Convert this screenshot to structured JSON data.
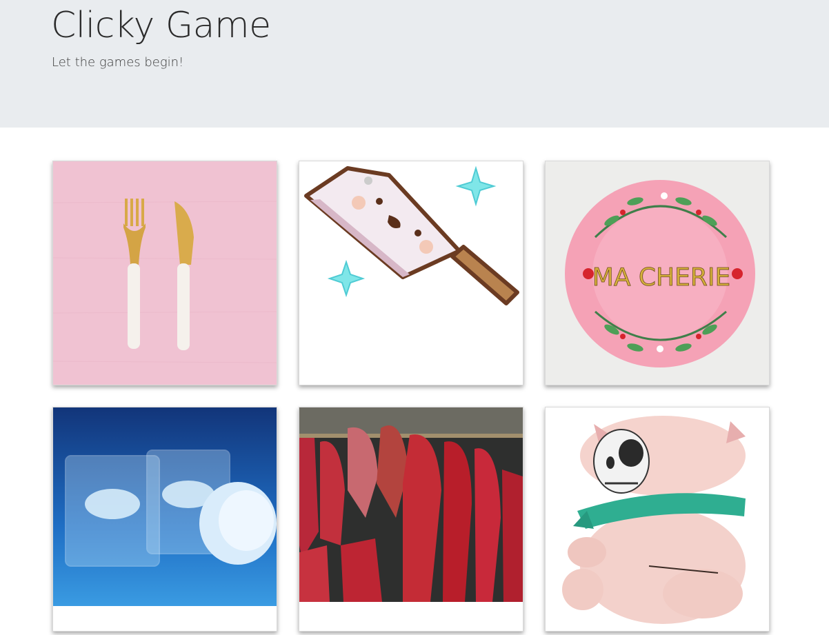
{
  "header": {
    "title": "Clicky Game",
    "subtitle": "Let the games begin!"
  },
  "cards": [
    {
      "id": "fork-knife",
      "description": "gold fork and knife on pink background",
      "text": ""
    },
    {
      "id": "cleaver",
      "description": "cute cartoon cleaver with sparkles",
      "text": ""
    },
    {
      "id": "plate",
      "description": "pink floral plate",
      "text": "MA CHERIE"
    },
    {
      "id": "ice-glasses",
      "description": "glasses with polar bear ice",
      "text": ""
    },
    {
      "id": "hanging-meat",
      "description": "hanging cuts of red meat",
      "text": ""
    },
    {
      "id": "pig-jar",
      "description": "pig skull cookie jar with green scarf",
      "text": ""
    }
  ],
  "colors": {
    "header_bg": "#e9ecef",
    "pink_bg": "#f0c3d3",
    "plate_pink": "#f6a6b9",
    "ice_blue": "#1f6ec4"
  }
}
